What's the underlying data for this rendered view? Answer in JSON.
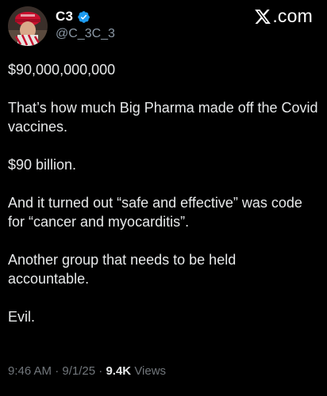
{
  "profile": {
    "display_name": "C3",
    "handle": "@C_3C_3",
    "avatar_icon": "avatar-image"
  },
  "brand": {
    "label": ".com",
    "icon": "x-logo-icon"
  },
  "post": {
    "paragraphs": [
      "$90,000,000,000",
      "That’s how much Big Pharma made off the Covid vaccines.",
      "$90 billion.",
      "And it turned out “safe and effective” was code for “cancer and myocarditis”.",
      "Another group that needs to be held accountable.",
      "Evil."
    ]
  },
  "meta": {
    "time": "9:46 AM",
    "date": "9/1/25",
    "separator": " · ",
    "views_count": "9.4K",
    "views_label": "Views"
  },
  "colors": {
    "background": "#000000",
    "text": "#e7e9ea",
    "muted": "#71767b",
    "verified": "#1d9bf0"
  }
}
